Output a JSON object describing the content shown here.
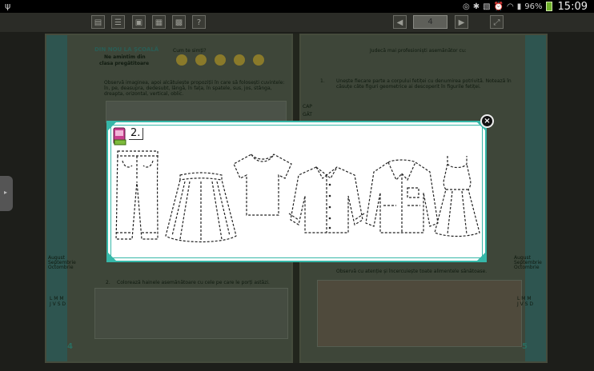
{
  "status_bar": {
    "battery_level": "96%",
    "time": "15:09",
    "icons": [
      "usb-icon",
      "mute-icon",
      "bluetooth-icon",
      "nfc-icon",
      "alarm-icon",
      "wifi-icon",
      "signal-icon",
      "battery-icon"
    ]
  },
  "toolbar": {
    "buttons": [
      "page-view-icon",
      "list-view-icon",
      "bookmark-icon",
      "notes-icon",
      "grid-view-icon",
      "help-icon"
    ],
    "help_label": "?",
    "page_number": "4"
  },
  "left_page": {
    "title": "DIN NOU LA ȘCOALĂ",
    "subtitle_1": "Ne amintim din",
    "subtitle_2": "clasa pregătitoare",
    "mood_question": "Cum te simți?",
    "exercise_1": "Observă imaginea, apoi alcătuiește propoziții în care să folosești cuvintele: în, pe, deasupra, dedesubt, lângă, în fața, în spatele, sus, jos, stânga, dreapta, orizontal, vertical, oblic.",
    "exercise_2_number": "2.",
    "exercise_2": "Colorează hainele asemănătoare cu cele pe care le porți astăzi.",
    "months": "August\nSeptembrie\nOctombrie",
    "weekdays": "L M M\nJ V S D",
    "page_num": "4"
  },
  "right_page": {
    "header": "Judecă mai profesioniști asemănător cu:",
    "exercise_1_number": "1.",
    "exercise_1": "Unește fiecare parte a corpului fetiței cu denumirea potrivită. Notează în căsuțe câte figuri geometrice ai descoperit în figurile fetiței.",
    "labels": [
      "CAP",
      "GÂT"
    ],
    "exercise_3": "Observă cu atenție și încercuiește toate alimentele sănătoase.",
    "months": "August\nSeptembrie\nOctombrie",
    "weekdays": "L M M\nJ V S D",
    "page_num": "5"
  },
  "modal": {
    "exercise_number": "2.",
    "close_label": "×",
    "items": [
      "trousers",
      "skirt",
      "t-shirt",
      "shirt",
      "jacket",
      "dress"
    ]
  },
  "side_handle": {
    "label": "▸"
  },
  "colors": {
    "teal_accent": "#36b7a8",
    "book_bg": "#3e4639",
    "status_bg": "#000000",
    "toolbar_bg": "#2b2c27"
  }
}
